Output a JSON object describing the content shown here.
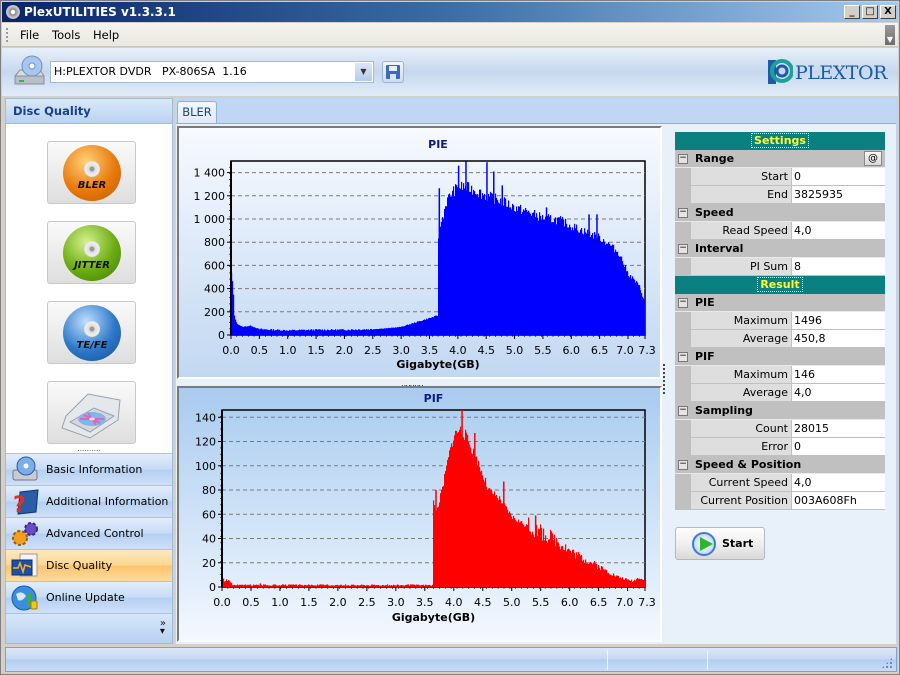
{
  "window": {
    "title": "PlexUTILITIES v1.3.3.1",
    "controls": {
      "minimize": "_",
      "maximize": "□",
      "close": "X"
    }
  },
  "menu": {
    "items": [
      "File",
      "Tools",
      "Help"
    ]
  },
  "toolbar": {
    "drive_select_value": "H:PLEXTOR DVDR   PX-806SA  1.16",
    "drive_icon": "optical-drive-icon",
    "save_icon": "floppy-save-icon",
    "logo_text": "PLEXTOR"
  },
  "sidebar": {
    "header": "Disc Quality",
    "tools": [
      {
        "label": "BLER",
        "color": "#e87a0c"
      },
      {
        "label": "JITTER",
        "color": "#6cac12"
      },
      {
        "label": "TE/FE",
        "color": "#2d78c8"
      },
      {
        "label": "",
        "icon": "drive-tray-icon"
      }
    ],
    "nav": [
      {
        "label": "Basic Information",
        "icon": "drive-info-icon",
        "active": false
      },
      {
        "label": "Additional Information",
        "icon": "help-book-icon",
        "active": false
      },
      {
        "label": "Advanced Control",
        "icon": "gears-icon",
        "active": false
      },
      {
        "label": "Disc Quality",
        "icon": "quality-graph-icon",
        "active": true
      },
      {
        "label": "Online Update",
        "icon": "globe-update-icon",
        "active": false
      }
    ],
    "more_icon": "chevron-double-down-icon"
  },
  "tabs": [
    {
      "label": "BLER",
      "active": true
    }
  ],
  "properties": {
    "settings_header": "Settings",
    "result_header": "Result",
    "groups": [
      {
        "name": "Range",
        "section": "settings",
        "rows": [
          {
            "k": "Start",
            "v": "0"
          },
          {
            "k": "End",
            "v": "3825935"
          }
        ],
        "button": "@"
      },
      {
        "name": "Speed",
        "section": "settings",
        "rows": [
          {
            "k": "Read Speed",
            "v": "4,0"
          }
        ]
      },
      {
        "name": "Interval",
        "section": "settings",
        "rows": [
          {
            "k": "PI Sum",
            "v": "8"
          }
        ]
      },
      {
        "name": "PIE",
        "section": "result",
        "rows": [
          {
            "k": "Maximum",
            "v": "1496"
          },
          {
            "k": "Average",
            "v": "450,8"
          }
        ]
      },
      {
        "name": "PIF",
        "section": "result",
        "rows": [
          {
            "k": "Maximum",
            "v": "146"
          },
          {
            "k": "Average",
            "v": "4,0"
          }
        ]
      },
      {
        "name": "Sampling",
        "section": "result",
        "rows": [
          {
            "k": "Count",
            "v": "28015"
          },
          {
            "k": "Error",
            "v": "0"
          }
        ]
      },
      {
        "name": "Speed & Position",
        "section": "result",
        "rows": [
          {
            "k": "Current Speed",
            "v": "4,0"
          },
          {
            "k": "Current Position",
            "v": "003A608Fh"
          }
        ]
      }
    ]
  },
  "start_button": {
    "label": "Start"
  },
  "chart_data": [
    {
      "type": "bar",
      "title": "PIE",
      "xlabel": "Gigabyte(GB)",
      "ylabel": "",
      "color": "#0000ff",
      "xlim": [
        0,
        7.3
      ],
      "ylim": [
        0,
        1500
      ],
      "xticks": [
        "0.0",
        "0.5",
        "1.0",
        "1.5",
        "2.0",
        "2.5",
        "3.0",
        "3.5",
        "4.0",
        "4.5",
        "5.0",
        "5.5",
        "6.0",
        "6.5",
        "7.0",
        "7.3"
      ],
      "xtick_values": [
        0,
        0.5,
        1,
        1.5,
        2,
        2.5,
        3,
        3.5,
        4,
        4.5,
        5,
        5.5,
        6,
        6.5,
        7,
        7.3
      ],
      "yticks": [
        "0",
        "200",
        "400",
        "600",
        "800",
        "1 000",
        "1 200",
        "1 400"
      ],
      "ytick_values": [
        0,
        200,
        400,
        600,
        800,
        1000,
        1200,
        1400
      ],
      "grid": true,
      "x": [
        0.0,
        0.02,
        0.04,
        0.06,
        0.1,
        0.2,
        0.35,
        0.5,
        1.0,
        1.5,
        2.0,
        2.5,
        2.8,
        3.0,
        3.2,
        3.4,
        3.6,
        3.65,
        3.66,
        3.7,
        3.8,
        3.9,
        4.0,
        4.1,
        4.3,
        4.5,
        4.8,
        5.0,
        5.3,
        5.5,
        5.8,
        6.0,
        6.3,
        6.5,
        6.7,
        6.85,
        7.0,
        7.1,
        7.2,
        7.3
      ],
      "values": [
        550,
        500,
        380,
        170,
        100,
        70,
        80,
        50,
        40,
        45,
        45,
        50,
        60,
        70,
        100,
        130,
        160,
        165,
        950,
        950,
        1150,
        1230,
        1270,
        1280,
        1250,
        1200,
        1150,
        1100,
        1050,
        1010,
        990,
        940,
        880,
        840,
        770,
        700,
        530,
        480,
        420,
        280
      ],
      "spikes": [
        {
          "x": 3.66,
          "y": 1265
        },
        {
          "x": 4.0,
          "y": 1460
        },
        {
          "x": 4.13,
          "y": 1496
        },
        {
          "x": 4.5,
          "y": 1490
        },
        {
          "x": 4.62,
          "y": 1410
        },
        {
          "x": 4.77,
          "y": 1290
        },
        {
          "x": 5.55,
          "y": 1100
        },
        {
          "x": 6.3,
          "y": 1040
        },
        {
          "x": 6.44,
          "y": 1040
        }
      ]
    },
    {
      "type": "bar",
      "title": "PIF",
      "xlabel": "Gigabyte(GB)",
      "ylabel": "",
      "color": "#ff0000",
      "xlim": [
        0,
        7.3
      ],
      "ylim": [
        0,
        146
      ],
      "xticks": [
        "0.0",
        "0.5",
        "1.0",
        "1.5",
        "2.0",
        "2.5",
        "3.0",
        "3.5",
        "4.0",
        "4.5",
        "5.0",
        "5.5",
        "6.0",
        "6.5",
        "7.0",
        "7.3"
      ],
      "xtick_values": [
        0,
        0.5,
        1,
        1.5,
        2,
        2.5,
        3,
        3.5,
        4,
        4.5,
        5,
        5.5,
        6,
        6.5,
        7,
        7.3
      ],
      "yticks": [
        "0",
        "20",
        "40",
        "60",
        "80",
        "100",
        "120",
        "140"
      ],
      "ytick_values": [
        0,
        20,
        40,
        60,
        80,
        100,
        120,
        140
      ],
      "grid": true,
      "x": [
        0.0,
        0.05,
        0.1,
        0.15,
        0.2,
        0.5,
        1.0,
        2.0,
        3.0,
        3.5,
        3.64,
        3.65,
        3.7,
        3.8,
        3.9,
        4.0,
        4.1,
        4.2,
        4.4,
        4.6,
        4.8,
        5.0,
        5.2,
        5.5,
        5.8,
        6.0,
        6.3,
        6.5,
        6.8,
        7.0,
        7.1,
        7.2,
        7.3
      ],
      "values": [
        8,
        5,
        6,
        4,
        1,
        1,
        1,
        1,
        1,
        1,
        1,
        70,
        62,
        80,
        105,
        125,
        130,
        125,
        105,
        80,
        72,
        58,
        52,
        45,
        38,
        30,
        22,
        17,
        9,
        6,
        5,
        8,
        5
      ],
      "spikes": [
        {
          "x": 3.68,
          "y": 80
        },
        {
          "x": 4.13,
          "y": 146
        },
        {
          "x": 4.35,
          "y": 127
        },
        {
          "x": 4.85,
          "y": 87
        },
        {
          "x": 5.4,
          "y": 59
        },
        {
          "x": 0.65,
          "y": 3
        }
      ]
    }
  ]
}
